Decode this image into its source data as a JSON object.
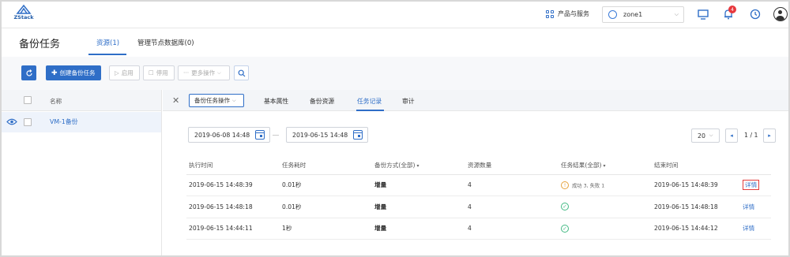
{
  "topbar": {
    "logo_text": "ZStack",
    "products_label": "产品与服务",
    "zone": "zone1",
    "notification_count": "4"
  },
  "page": {
    "title": "备份任务",
    "tabs": [
      {
        "label": "资源(1)",
        "active": true
      },
      {
        "label": "管理节点数据库(0)",
        "active": false
      }
    ]
  },
  "toolbar": {
    "create_label": "创建备份任务",
    "enable_label": "启用",
    "disable_label": "停用",
    "more_label": "更多操作"
  },
  "left": {
    "column_name": "名称",
    "rows": [
      {
        "name": "VM-1备份"
      }
    ]
  },
  "detail": {
    "ops_label": "备份任务操作",
    "tabs": [
      {
        "label": "基本属性",
        "active": false
      },
      {
        "label": "备份资源",
        "active": false
      },
      {
        "label": "任务记录",
        "active": true
      },
      {
        "label": "审计",
        "active": false
      }
    ],
    "date_start": "2019-06-08 14:48",
    "date_end": "2019-06-15 14:48",
    "page_size": "20",
    "page_info": "1 / 1",
    "columns": [
      "执行时间",
      "任务耗时",
      "备份方式(全部)",
      "资源数量",
      "任务结果(全部)",
      "结束时间"
    ],
    "records": [
      {
        "start": "2019-06-15 14:48:39",
        "duration": "0.01秒",
        "mode": "增量",
        "count": "4",
        "status": "warning",
        "result_text": "成功 3, 失败 1",
        "end": "2019-06-15 14:48:39",
        "action": "详情"
      },
      {
        "start": "2019-06-15 14:48:18",
        "duration": "0.01秒",
        "mode": "增量",
        "count": "4",
        "status": "success",
        "result_text": "",
        "end": "2019-06-15 14:48:18",
        "action": "详情"
      },
      {
        "start": "2019-06-15 14:44:11",
        "duration": "1秒",
        "mode": "增量",
        "count": "4",
        "status": "success",
        "result_text": "",
        "end": "2019-06-15 14:44:12",
        "action": "详情"
      }
    ]
  },
  "colors": {
    "accent": "#2f6ec7",
    "warning": "#e6a23c",
    "success": "#42b983",
    "highlight": "#e23c3c"
  }
}
